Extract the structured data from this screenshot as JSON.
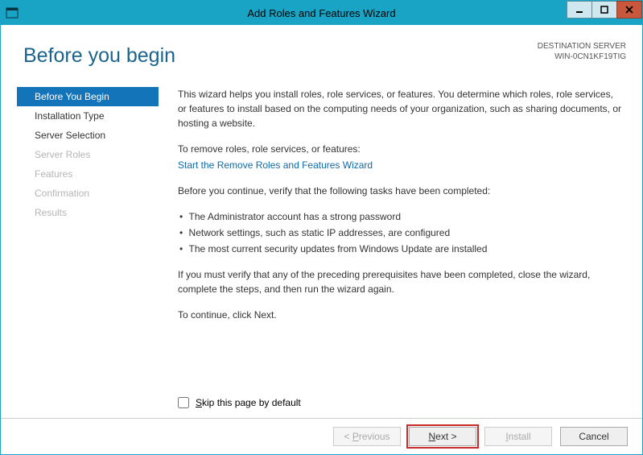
{
  "window": {
    "title": "Add Roles and Features Wizard"
  },
  "header": {
    "page_title": "Before you begin",
    "dest_label": "DESTINATION SERVER",
    "dest_name": "WIN-0CN1KF19TIG"
  },
  "nav": {
    "items": [
      {
        "label": "Before You Begin",
        "selected": true,
        "disabled": false
      },
      {
        "label": "Installation Type",
        "selected": false,
        "disabled": false
      },
      {
        "label": "Server Selection",
        "selected": false,
        "disabled": false
      },
      {
        "label": "Server Roles",
        "selected": false,
        "disabled": true
      },
      {
        "label": "Features",
        "selected": false,
        "disabled": true
      },
      {
        "label": "Confirmation",
        "selected": false,
        "disabled": true
      },
      {
        "label": "Results",
        "selected": false,
        "disabled": true
      }
    ]
  },
  "main": {
    "intro": "This wizard helps you install roles, role services, or features. You determine which roles, role services, or features to install based on the computing needs of your organization, such as sharing documents, or hosting a website.",
    "remove_label": "To remove roles, role services, or features:",
    "remove_link": "Start the Remove Roles and Features Wizard",
    "verify_intro": "Before you continue, verify that the following tasks have been completed:",
    "bullets": [
      "The Administrator account has a strong password",
      "Network settings, such as static IP addresses, are configured",
      "The most current security updates from Windows Update are installed"
    ],
    "verify_note": "If you must verify that any of the preceding prerequisites have been completed, close the wizard, complete the steps, and then run the wizard again.",
    "continue_note": "To continue, click Next.",
    "skip_label": "Skip this page by default"
  },
  "footer": {
    "previous": "< Previous",
    "next": "Next >",
    "install": "Install",
    "cancel": "Cancel"
  }
}
